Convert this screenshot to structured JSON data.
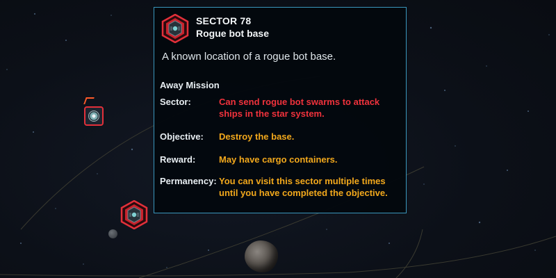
{
  "tooltip": {
    "sector_title": "SECTOR 78",
    "subtitle": "Rogue bot base",
    "description": "A known location of a rogue bot base.",
    "mission_heading": "Away Mission",
    "rows": [
      {
        "label": "Sector:",
        "value": "Can send rogue bot swarms to attack ships in the star system.",
        "color": "#f0323c"
      },
      {
        "label": "Objective:",
        "value": "Destroy the base.",
        "color": "#f2a81c"
      },
      {
        "label": "Reward:",
        "value": "May have cargo containers.",
        "color": "#f2a81c"
      },
      {
        "label": "Permanency:",
        "value": "You can visit this sector multiple times until you have completed the objective.",
        "color": "#f2a81c"
      }
    ],
    "icon": "rogue-bot-base-icon",
    "border_color": "#3a97bd"
  },
  "map": {
    "markers": [
      {
        "name": "rogue-bot-base-marker",
        "icon": "hexagon-bot-icon",
        "color": "#e3303a"
      },
      {
        "name": "ship-marker",
        "icon": "ship-icon",
        "color": "#e3303a"
      }
    ]
  },
  "colors": {
    "hostile_red": "#e3303a",
    "warning_text_red": "#f0323c",
    "info_text_gold": "#f2a81c"
  }
}
